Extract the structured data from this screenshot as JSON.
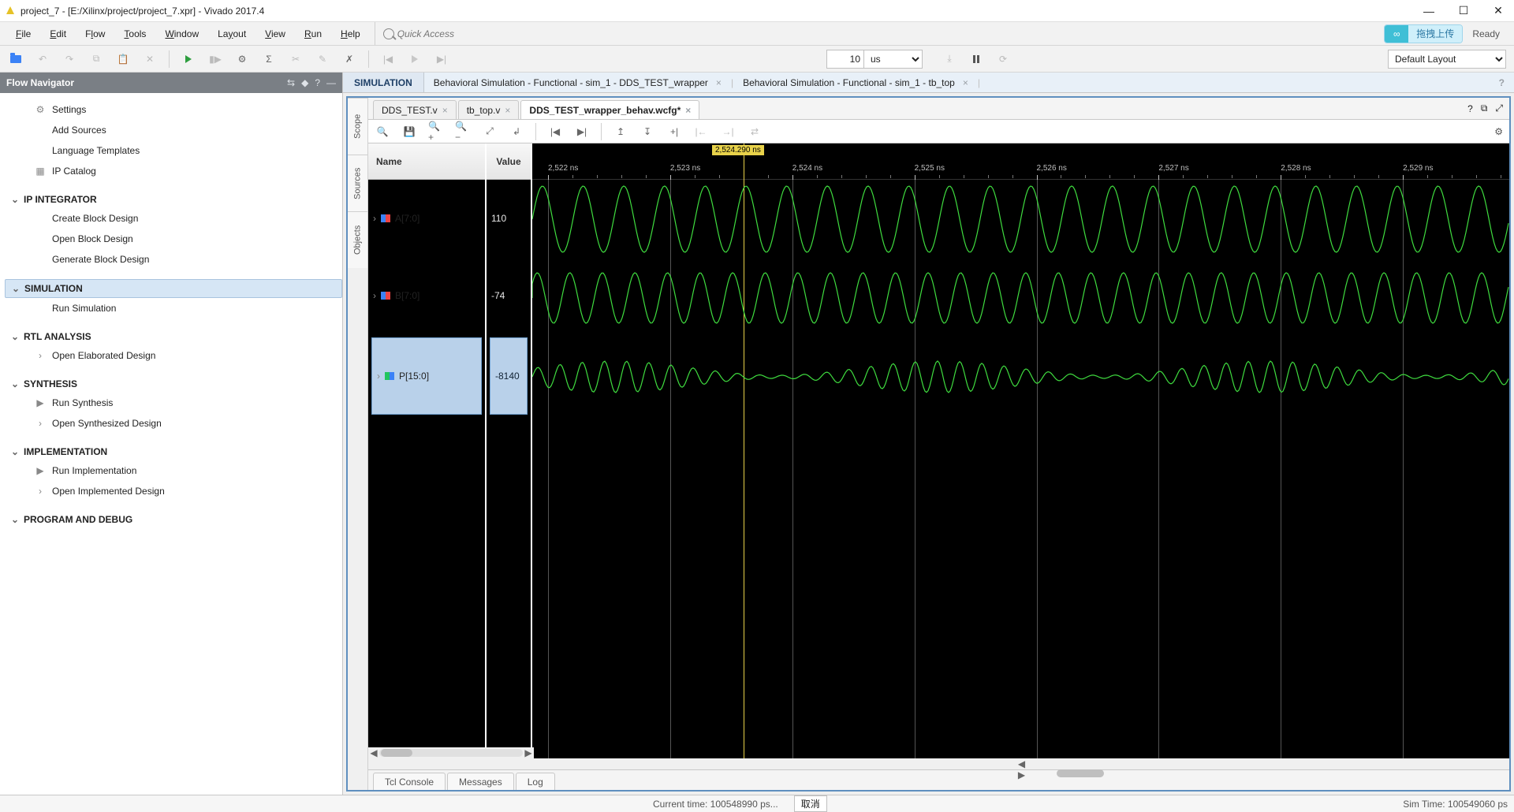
{
  "window": {
    "title": "project_7 - [E:/Xilinx/project/project_7.xpr] - Vivado 2017.4"
  },
  "menu": {
    "items": [
      "File",
      "Edit",
      "Flow",
      "Tools",
      "Window",
      "Layout",
      "View",
      "Run",
      "Help"
    ],
    "search_placeholder": "Quick Access",
    "pill_label": "拖拽上传",
    "ready": "Ready"
  },
  "toolbar": {
    "time_value": "10",
    "time_unit": "us",
    "layout": "Default Layout"
  },
  "flow_navigator": {
    "title": "Flow Navigator",
    "groups": [
      {
        "name": "",
        "items": [
          {
            "label": "Settings",
            "icon": "gear"
          },
          {
            "label": "Add Sources",
            "icon": ""
          },
          {
            "label": "Language Templates",
            "icon": ""
          },
          {
            "label": "IP Catalog",
            "icon": "chip"
          }
        ]
      },
      {
        "name": "IP INTEGRATOR",
        "items": [
          {
            "label": "Create Block Design"
          },
          {
            "label": "Open Block Design"
          },
          {
            "label": "Generate Block Design"
          }
        ]
      },
      {
        "name": "SIMULATION",
        "selected": true,
        "items": [
          {
            "label": "Run Simulation"
          }
        ]
      },
      {
        "name": "RTL ANALYSIS",
        "items": [
          {
            "label": "Open Elaborated Design",
            "chev": true
          }
        ]
      },
      {
        "name": "SYNTHESIS",
        "items": [
          {
            "label": "Run Synthesis",
            "play": true
          },
          {
            "label": "Open Synthesized Design",
            "chev": true
          }
        ]
      },
      {
        "name": "IMPLEMENTATION",
        "items": [
          {
            "label": "Run Implementation",
            "play": true
          },
          {
            "label": "Open Implemented Design",
            "chev": true
          }
        ]
      },
      {
        "name": "PROGRAM AND DEBUG",
        "items": []
      }
    ]
  },
  "simulation": {
    "header_label": "SIMULATION",
    "crumbs": [
      "Behavioral Simulation - Functional - sim_1 - DDS_TEST_wrapper",
      "Behavioral Simulation - Functional - sim_1 - tb_top"
    ],
    "vtabs": [
      "Scope",
      "Sources",
      "Objects"
    ],
    "file_tabs": [
      {
        "label": "DDS_TEST.v",
        "active": false
      },
      {
        "label": "tb_top.v",
        "active": false
      },
      {
        "label": "DDS_TEST_wrapper_behav.wcfg*",
        "active": true
      }
    ],
    "name_header": "Name",
    "value_header": "Value",
    "signals": [
      {
        "name": "A[7:0]",
        "value": "110",
        "selected": false
      },
      {
        "name": "B[7:0]",
        "value": "-74",
        "selected": false
      },
      {
        "name": "P[15:0]",
        "value": "-8140",
        "selected": true
      }
    ],
    "marker_label": "2,524.290 ns",
    "ticks": [
      "2,522 ns",
      "2,523 ns",
      "2,524 ns",
      "2,525 ns",
      "2,526 ns",
      "2,527 ns",
      "2,528 ns",
      "2,529 ns"
    ],
    "bottom_tabs": [
      "Tcl Console",
      "Messages",
      "Log"
    ]
  },
  "status": {
    "current": "Current time: 100548990 ps...",
    "cancel": "取消",
    "sim": "Sim Time: 100549060 ps"
  }
}
